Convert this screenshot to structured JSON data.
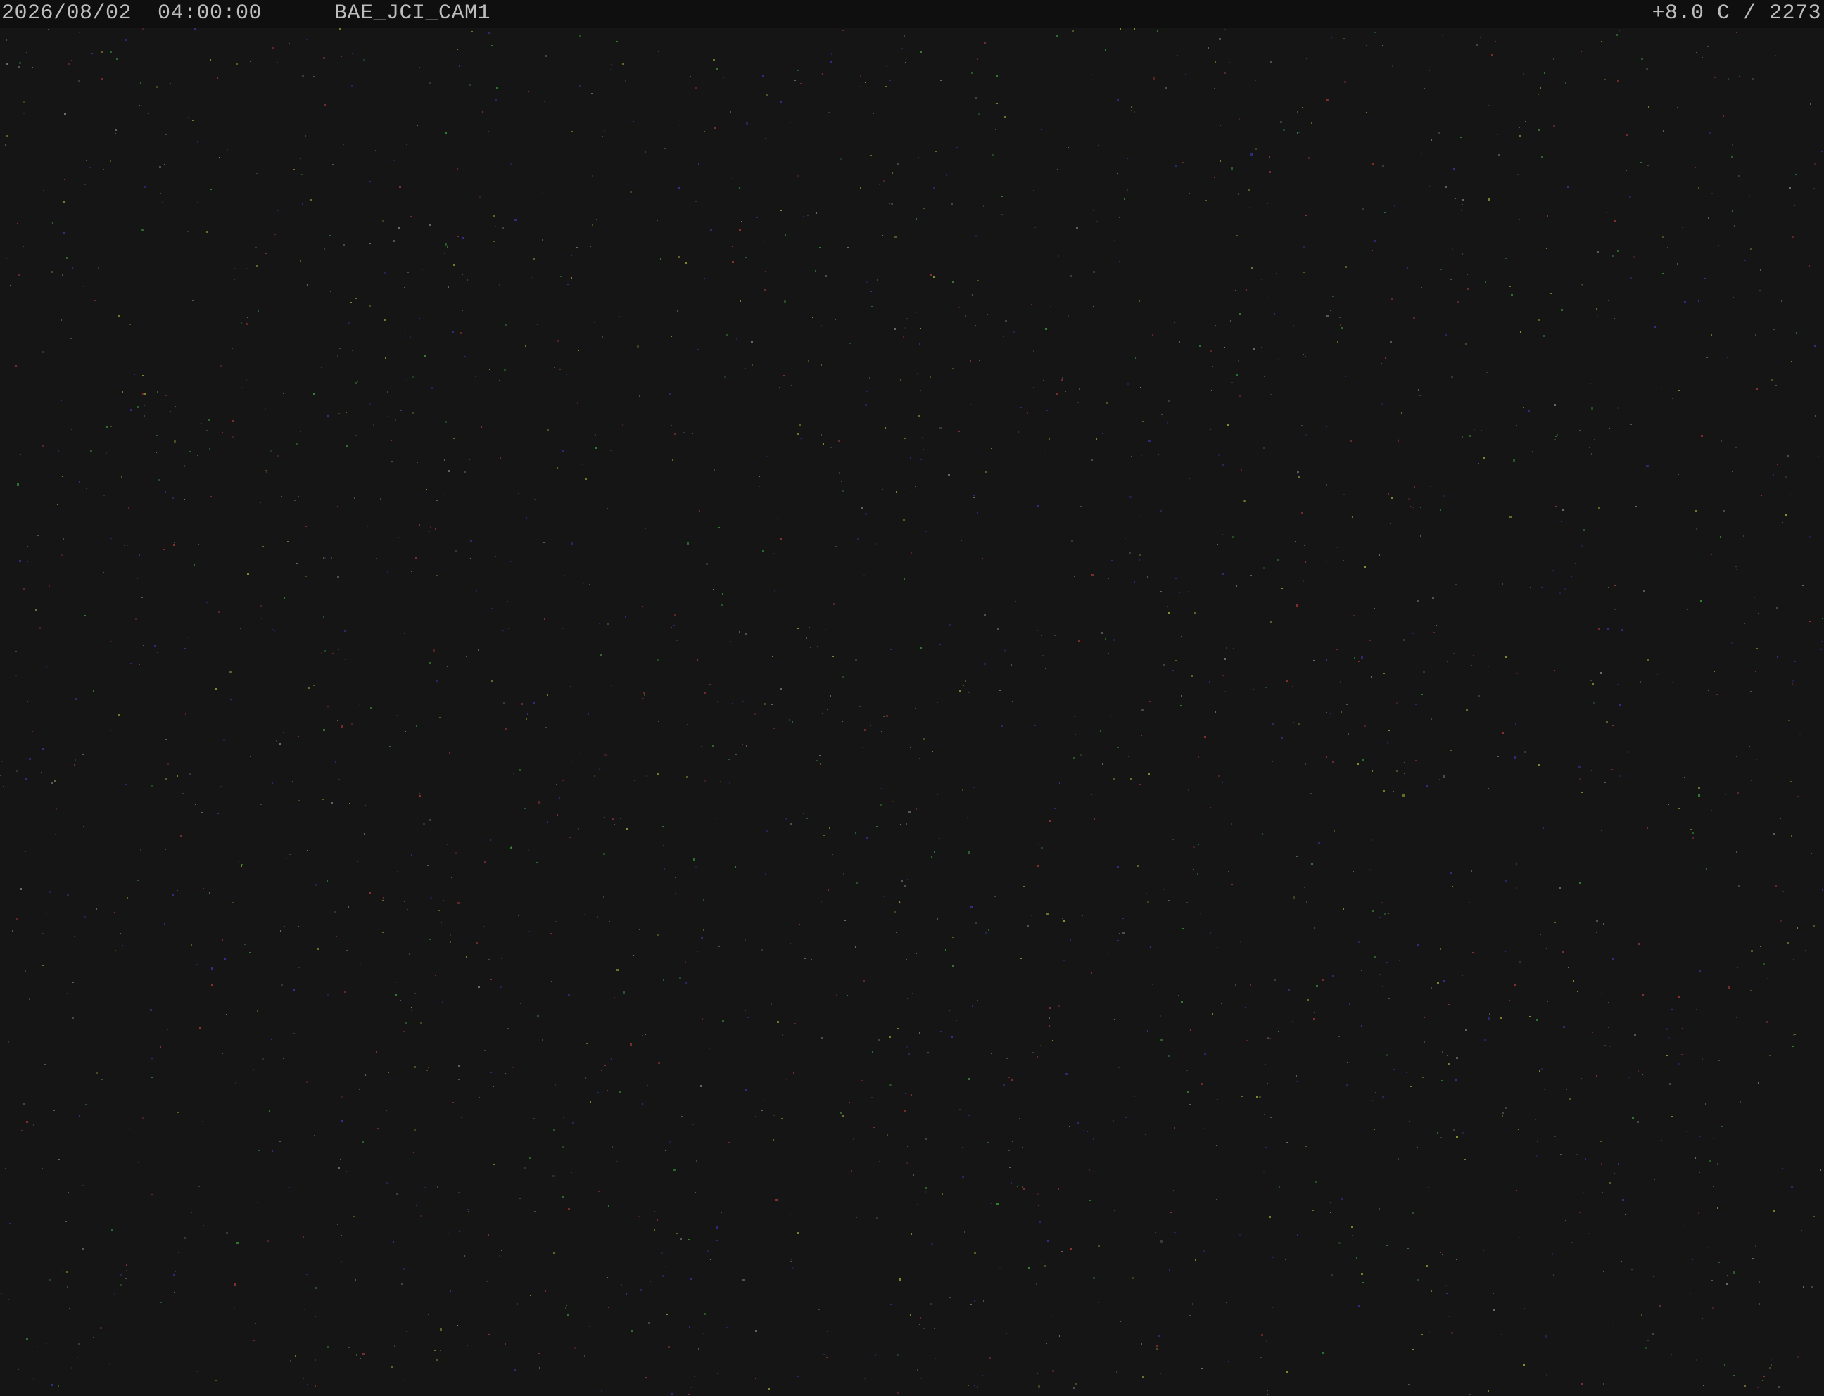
{
  "overlay": {
    "datetime": "2026/08/02  04:00:00",
    "camera_name": "BAE_JCI_CAM1",
    "status": "+8.0 C / 2273"
  },
  "colors": {
    "sky_background": "#151516",
    "overlay_bar": "#0f0f0f",
    "overlay_text": "#bdbdbd",
    "noise_pixel_colors": [
      "#b23a3a",
      "#3a3ab2",
      "#3aa03a",
      "#8a8a8a",
      "#b2b23a"
    ]
  },
  "icons": []
}
